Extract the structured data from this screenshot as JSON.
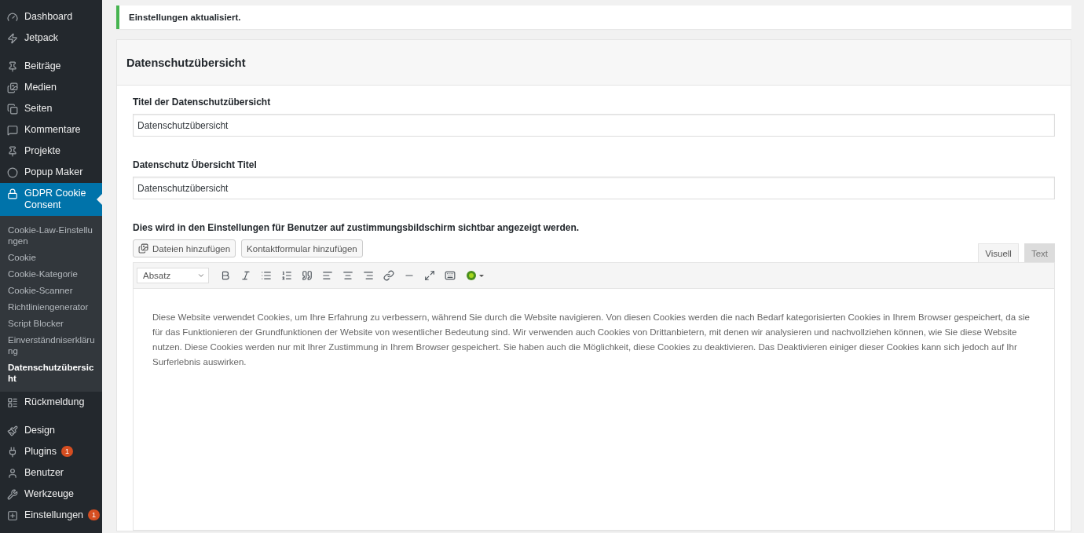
{
  "sidebar": {
    "groups": [
      [
        {
          "label": "Dashboard",
          "selected": false
        },
        {
          "label": "Jetpack",
          "selected": false
        }
      ],
      [
        {
          "label": "Beiträge",
          "selected": false
        },
        {
          "label": "Medien",
          "selected": false
        },
        {
          "label": "Seiten",
          "selected": false
        },
        {
          "label": "Kommentare",
          "selected": false
        },
        {
          "label": "Projekte",
          "selected": false
        },
        {
          "label": "Popup Maker",
          "selected": false
        },
        {
          "label": "GDPR Cookie Consent",
          "selected": true,
          "children": [
            {
              "label": "Cookie-Law-Einstellungen",
              "selected": false
            },
            {
              "label": "Cookie",
              "selected": false
            },
            {
              "label": "Cookie-Kategorie",
              "selected": false
            },
            {
              "label": "Cookie-Scanner",
              "selected": false
            },
            {
              "label": "Richtliniengenerator",
              "selected": false
            },
            {
              "label": "Script Blocker",
              "selected": false
            },
            {
              "label": "Einverständniserklärung",
              "selected": false
            },
            {
              "label": "Datenschutzübersicht",
              "selected": true
            }
          ]
        },
        {
          "label": "Rückmeldung",
          "selected": false
        }
      ],
      [
        {
          "label": "Design",
          "selected": false
        },
        {
          "label": "Plugins",
          "selected": false,
          "badge": "1"
        },
        {
          "label": "Benutzer",
          "selected": false
        },
        {
          "label": "Werkzeuge",
          "selected": false
        },
        {
          "label": "Einstellungen",
          "selected": false,
          "badge": "1"
        }
      ]
    ]
  },
  "notice": "Einstellungen aktualisiert.",
  "panel": {
    "title": "Datenschutzübersicht",
    "fields": [
      {
        "label": "Titel der Datenschutzübersicht",
        "value": "Datenschutzübersicht"
      },
      {
        "label": "Datenschutz Übersicht Titel",
        "value": "Datenschutzübersicht"
      }
    ],
    "editor": {
      "label": "Dies wird in den Einstellungen für Benutzer auf zustimmungsbildschirm sichtbar angezeigt werden.",
      "media_buttons": [
        "Dateien hinzufügen",
        "Kontaktformular hinzufügen"
      ],
      "tabs": [
        {
          "label": "Visuell",
          "selected": true
        },
        {
          "label": "Text",
          "selected": false
        }
      ],
      "format": "Absatz",
      "content": "Diese Website verwendet Cookies, um Ihre Erfahrung zu verbessern, während Sie durch die Website navigieren. Von diesen Cookies werden die nach Bedarf kategorisierten Cookies in Ihrem Browser gespeichert, da sie für das Funktionieren der Grundfunktionen der Website von wesentlicher Bedeutung sind. Wir verwenden auch Cookies von Drittanbietern, mit denen wir analysieren und nachvollziehen können, wie Sie diese Website nutzen. Diese Cookies werden nur mit Ihrer Zustimmung in Ihrem Browser gespeichert. Sie haben auch die Möglichkeit, diese Cookies zu deaktivieren. Das Deaktivieren einiger dieser Cookies kann sich jedoch auf Ihr Surferlebnis auswirken."
    }
  }
}
